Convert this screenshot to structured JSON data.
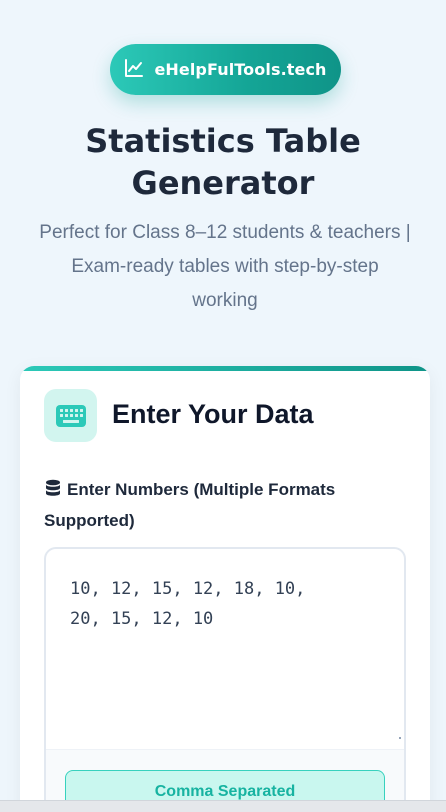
{
  "brand": {
    "name": "eHelpFulTools.tech",
    "icon": "chart-line-icon"
  },
  "header": {
    "title_line1": "Statistics Table",
    "title_line2": "Generator",
    "subtitle_line1": "Perfect for Class 8–12 students & teachers |",
    "subtitle_line2": "Exam-ready tables with step-by-step",
    "subtitle_line3": "working"
  },
  "card": {
    "icon": "keyboard-icon",
    "title": "Enter Your Data",
    "field_icon": "database-icon",
    "field_label_line1": "Enter Numbers (Multiple Formats",
    "field_label_line2": "Supported)",
    "input_value": "10, 12, 15, 12, 18, 10,\n20, 15, 12, 10",
    "format_button": "Comma Separated"
  },
  "colors": {
    "accent": "#14a596",
    "accent_light": "#c9f7ef",
    "text_dark": "#1e293b",
    "text_muted": "#64748b"
  }
}
